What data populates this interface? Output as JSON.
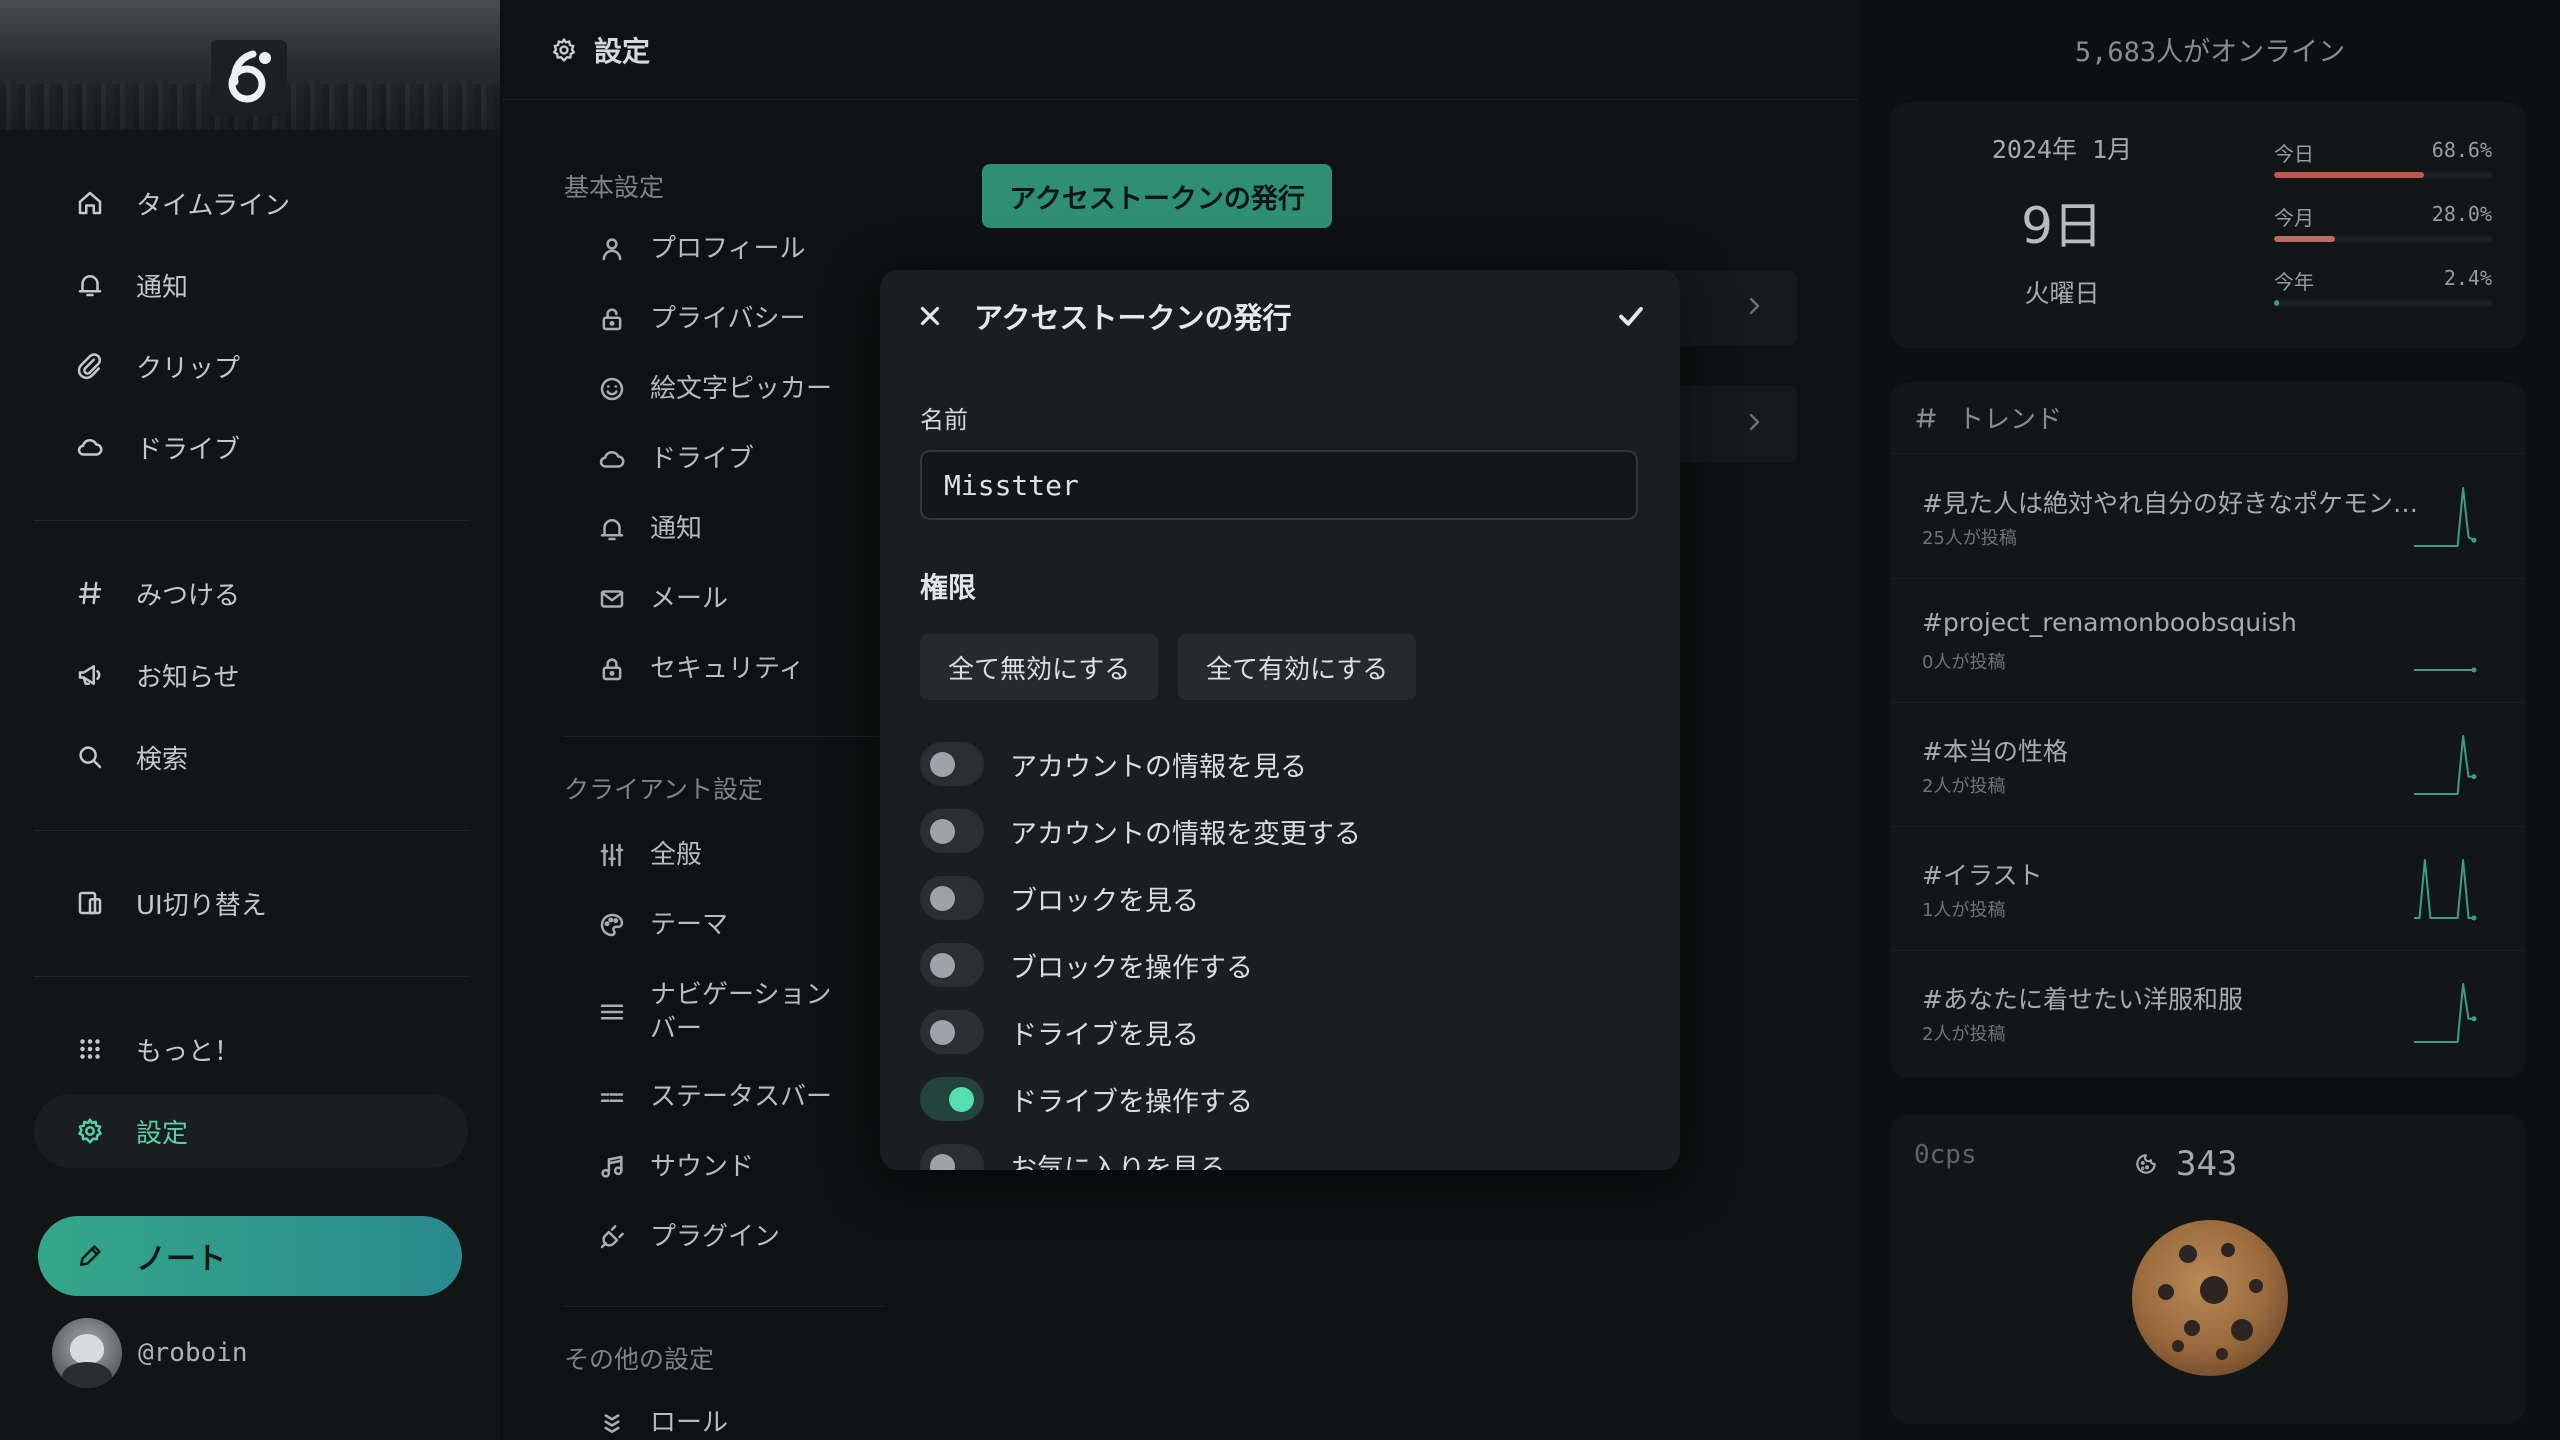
{
  "sidebar": {
    "nav": [
      {
        "label": "タイムライン",
        "icon": "home-icon"
      },
      {
        "label": "通知",
        "icon": "bell-icon"
      },
      {
        "label": "クリップ",
        "icon": "paperclip-icon"
      },
      {
        "label": "ドライブ",
        "icon": "cloud-icon"
      },
      {
        "label": "みつける",
        "icon": "hash-icon"
      },
      {
        "label": "お知らせ",
        "icon": "megaphone-icon"
      },
      {
        "label": "検索",
        "icon": "search-icon"
      },
      {
        "label": "UI切り替え",
        "icon": "devices-icon"
      },
      {
        "label": "もっと！",
        "icon": "grid-dots-icon"
      },
      {
        "label": "設定",
        "icon": "gear-icon"
      }
    ],
    "note_button": "ノート",
    "account": "@roboin"
  },
  "main": {
    "header_title": "設定",
    "issue_button": "アクセストークンの発行",
    "sections": {
      "basic": "基本設定",
      "client": "クライアント設定",
      "other": "その他の設定"
    },
    "basic_items": [
      "プロフィール",
      "プライバシー",
      "絵文字ピッカー",
      "ドライブ",
      "通知",
      "メール",
      "セキュリティ"
    ],
    "client_items": [
      "全般",
      "テーマ",
      "ナビゲーション\nバー",
      "ステータスバー",
      "サウンド",
      "プラグイン"
    ],
    "other_items": [
      "ロール"
    ]
  },
  "modal": {
    "title": "アクセストークンの発行",
    "name_label": "名前",
    "name_value": "Misstter",
    "permissions_title": "権限",
    "disable_all": "全て無効にする",
    "enable_all": "全て有効にする",
    "permissions": [
      {
        "label": "アカウントの情報を見る",
        "on": false
      },
      {
        "label": "アカウントの情報を変更する",
        "on": false
      },
      {
        "label": "ブロックを見る",
        "on": false
      },
      {
        "label": "ブロックを操作する",
        "on": false
      },
      {
        "label": "ドライブを見る",
        "on": false
      },
      {
        "label": "ドライブを操作する",
        "on": true
      },
      {
        "label": "お気に入りを見る",
        "on": false
      }
    ]
  },
  "right": {
    "online": "5,683人がオンライン",
    "calendar": {
      "year_month": "2024年 1月",
      "day": "9日",
      "weekday": "火曜日",
      "progress": [
        {
          "label": "今日",
          "value": "68.6%",
          "fraction": 0.686,
          "color": "#c0574d"
        },
        {
          "label": "今月",
          "value": "28.0%",
          "fraction": 0.28,
          "color": "#b96f5f"
        },
        {
          "label": "今年",
          "value": "2.4%",
          "fraction": 0.024,
          "color": "#3d9e86"
        }
      ]
    },
    "trends_title": "トレンド",
    "trends": [
      {
        "tag": "#見た人は絶対やれ自分の好きなポケモン…",
        "count": "25人が投稿",
        "chart": [
          0,
          0,
          0,
          0,
          0,
          0,
          0,
          0,
          0,
          1,
          0.15,
          0.1
        ]
      },
      {
        "tag": "#project_renamonboobsquish",
        "count": "0人が投稿",
        "chart": [
          0,
          0,
          0,
          0,
          0,
          0,
          0,
          0,
          0,
          0,
          0,
          0
        ]
      },
      {
        "tag": "#本当の性格",
        "count": "2人が投稿",
        "chart": [
          0,
          0,
          0,
          0,
          0,
          0,
          0,
          0,
          0,
          1,
          0.3,
          0.3
        ]
      },
      {
        "tag": "#イラスト",
        "count": "1人が投稿",
        "chart": [
          0,
          0,
          1,
          0,
          0,
          0,
          0,
          0,
          0,
          1,
          0,
          0
        ]
      },
      {
        "tag": "#あなたに着せたい洋服和服",
        "count": "2人が投稿",
        "chart": [
          0,
          0,
          0,
          0,
          0,
          0,
          0,
          0,
          0,
          1,
          0.4,
          0.4
        ]
      }
    ],
    "cookie": {
      "cps": "0cps",
      "count": "343"
    }
  },
  "colors": {
    "accent": "#5ad0a6",
    "toggle_on": "#53dfb0",
    "note_gradient_start": "#33a789",
    "note_gradient_end": "#2a8a8e",
    "trend_line": "#3a9e85"
  }
}
